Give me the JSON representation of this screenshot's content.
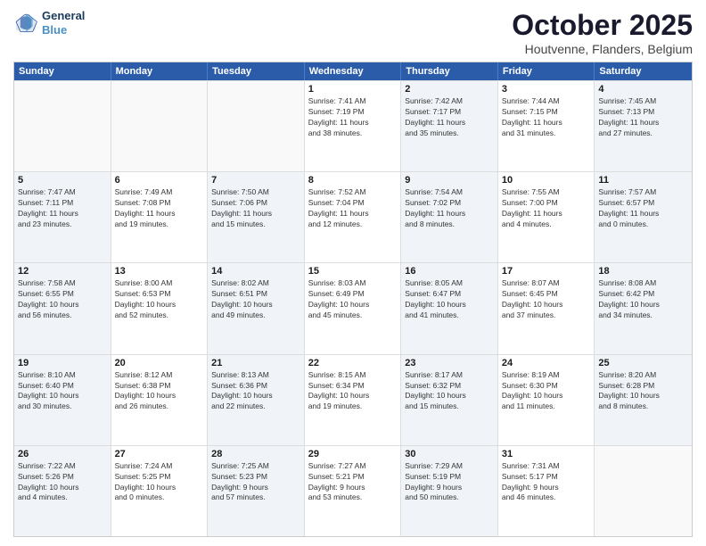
{
  "header": {
    "logo_line1": "General",
    "logo_line2": "Blue",
    "month": "October 2025",
    "location": "Houtvenne, Flanders, Belgium"
  },
  "weekdays": [
    "Sunday",
    "Monday",
    "Tuesday",
    "Wednesday",
    "Thursday",
    "Friday",
    "Saturday"
  ],
  "rows": [
    [
      {
        "day": "",
        "info": "",
        "shaded": false,
        "empty": true
      },
      {
        "day": "",
        "info": "",
        "shaded": false,
        "empty": true
      },
      {
        "day": "",
        "info": "",
        "shaded": false,
        "empty": true
      },
      {
        "day": "1",
        "info": "Sunrise: 7:41 AM\nSunset: 7:19 PM\nDaylight: 11 hours\nand 38 minutes.",
        "shaded": false
      },
      {
        "day": "2",
        "info": "Sunrise: 7:42 AM\nSunset: 7:17 PM\nDaylight: 11 hours\nand 35 minutes.",
        "shaded": true
      },
      {
        "day": "3",
        "info": "Sunrise: 7:44 AM\nSunset: 7:15 PM\nDaylight: 11 hours\nand 31 minutes.",
        "shaded": false
      },
      {
        "day": "4",
        "info": "Sunrise: 7:45 AM\nSunset: 7:13 PM\nDaylight: 11 hours\nand 27 minutes.",
        "shaded": true
      }
    ],
    [
      {
        "day": "5",
        "info": "Sunrise: 7:47 AM\nSunset: 7:11 PM\nDaylight: 11 hours\nand 23 minutes.",
        "shaded": true
      },
      {
        "day": "6",
        "info": "Sunrise: 7:49 AM\nSunset: 7:08 PM\nDaylight: 11 hours\nand 19 minutes.",
        "shaded": false
      },
      {
        "day": "7",
        "info": "Sunrise: 7:50 AM\nSunset: 7:06 PM\nDaylight: 11 hours\nand 15 minutes.",
        "shaded": true
      },
      {
        "day": "8",
        "info": "Sunrise: 7:52 AM\nSunset: 7:04 PM\nDaylight: 11 hours\nand 12 minutes.",
        "shaded": false
      },
      {
        "day": "9",
        "info": "Sunrise: 7:54 AM\nSunset: 7:02 PM\nDaylight: 11 hours\nand 8 minutes.",
        "shaded": true
      },
      {
        "day": "10",
        "info": "Sunrise: 7:55 AM\nSunset: 7:00 PM\nDaylight: 11 hours\nand 4 minutes.",
        "shaded": false
      },
      {
        "day": "11",
        "info": "Sunrise: 7:57 AM\nSunset: 6:57 PM\nDaylight: 11 hours\nand 0 minutes.",
        "shaded": true
      }
    ],
    [
      {
        "day": "12",
        "info": "Sunrise: 7:58 AM\nSunset: 6:55 PM\nDaylight: 10 hours\nand 56 minutes.",
        "shaded": true
      },
      {
        "day": "13",
        "info": "Sunrise: 8:00 AM\nSunset: 6:53 PM\nDaylight: 10 hours\nand 52 minutes.",
        "shaded": false
      },
      {
        "day": "14",
        "info": "Sunrise: 8:02 AM\nSunset: 6:51 PM\nDaylight: 10 hours\nand 49 minutes.",
        "shaded": true
      },
      {
        "day": "15",
        "info": "Sunrise: 8:03 AM\nSunset: 6:49 PM\nDaylight: 10 hours\nand 45 minutes.",
        "shaded": false
      },
      {
        "day": "16",
        "info": "Sunrise: 8:05 AM\nSunset: 6:47 PM\nDaylight: 10 hours\nand 41 minutes.",
        "shaded": true
      },
      {
        "day": "17",
        "info": "Sunrise: 8:07 AM\nSunset: 6:45 PM\nDaylight: 10 hours\nand 37 minutes.",
        "shaded": false
      },
      {
        "day": "18",
        "info": "Sunrise: 8:08 AM\nSunset: 6:42 PM\nDaylight: 10 hours\nand 34 minutes.",
        "shaded": true
      }
    ],
    [
      {
        "day": "19",
        "info": "Sunrise: 8:10 AM\nSunset: 6:40 PM\nDaylight: 10 hours\nand 30 minutes.",
        "shaded": true
      },
      {
        "day": "20",
        "info": "Sunrise: 8:12 AM\nSunset: 6:38 PM\nDaylight: 10 hours\nand 26 minutes.",
        "shaded": false
      },
      {
        "day": "21",
        "info": "Sunrise: 8:13 AM\nSunset: 6:36 PM\nDaylight: 10 hours\nand 22 minutes.",
        "shaded": true
      },
      {
        "day": "22",
        "info": "Sunrise: 8:15 AM\nSunset: 6:34 PM\nDaylight: 10 hours\nand 19 minutes.",
        "shaded": false
      },
      {
        "day": "23",
        "info": "Sunrise: 8:17 AM\nSunset: 6:32 PM\nDaylight: 10 hours\nand 15 minutes.",
        "shaded": true
      },
      {
        "day": "24",
        "info": "Sunrise: 8:19 AM\nSunset: 6:30 PM\nDaylight: 10 hours\nand 11 minutes.",
        "shaded": false
      },
      {
        "day": "25",
        "info": "Sunrise: 8:20 AM\nSunset: 6:28 PM\nDaylight: 10 hours\nand 8 minutes.",
        "shaded": true
      }
    ],
    [
      {
        "day": "26",
        "info": "Sunrise: 7:22 AM\nSunset: 5:26 PM\nDaylight: 10 hours\nand 4 minutes.",
        "shaded": true
      },
      {
        "day": "27",
        "info": "Sunrise: 7:24 AM\nSunset: 5:25 PM\nDaylight: 10 hours\nand 0 minutes.",
        "shaded": false
      },
      {
        "day": "28",
        "info": "Sunrise: 7:25 AM\nSunset: 5:23 PM\nDaylight: 9 hours\nand 57 minutes.",
        "shaded": true
      },
      {
        "day": "29",
        "info": "Sunrise: 7:27 AM\nSunset: 5:21 PM\nDaylight: 9 hours\nand 53 minutes.",
        "shaded": false
      },
      {
        "day": "30",
        "info": "Sunrise: 7:29 AM\nSunset: 5:19 PM\nDaylight: 9 hours\nand 50 minutes.",
        "shaded": true
      },
      {
        "day": "31",
        "info": "Sunrise: 7:31 AM\nSunset: 5:17 PM\nDaylight: 9 hours\nand 46 minutes.",
        "shaded": false
      },
      {
        "day": "",
        "info": "",
        "shaded": true,
        "empty": true
      }
    ]
  ]
}
